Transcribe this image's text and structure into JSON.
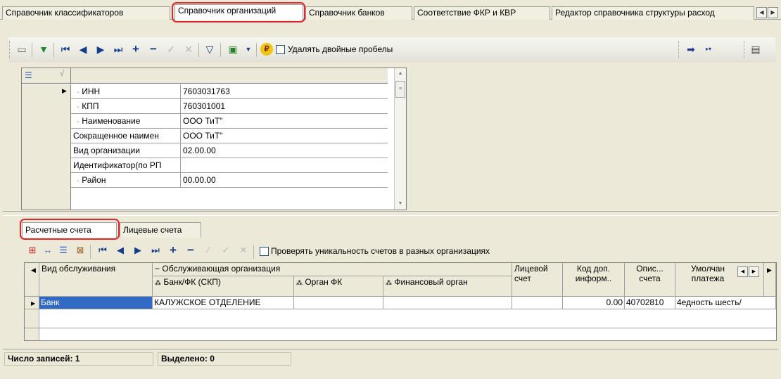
{
  "tabs": [
    {
      "label": "Справочник классификаторов"
    },
    {
      "label": "Справочник организаций"
    },
    {
      "label": "Справочник банков"
    },
    {
      "label": "Соответствие ФКР и КВР"
    },
    {
      "label": "Редактор справочника структуры расход"
    }
  ],
  "active_tab_index": 1,
  "toolbar": {
    "remove_double_spaces_label": "Удалять двойные пробелы",
    "remove_double_spaces_checked": false,
    "ruble_symbol": "₽"
  },
  "organization_fields": [
    {
      "name": "ИНН",
      "value": "7603031763",
      "required": true
    },
    {
      "name": "КПП",
      "value": "760301001",
      "required": true
    },
    {
      "name": "Наименование",
      "value": "ООО ТиТ\"",
      "required": true
    },
    {
      "name": "Сокращенное наимен",
      "value": "ООО ТиТ\"",
      "required": false
    },
    {
      "name": "Вид организации",
      "value": "02.00.00",
      "required": false
    },
    {
      "name": "Идентификатор(по РП",
      "value": "",
      "required": false
    },
    {
      "name": "Район",
      "value": "00.00.00",
      "required": true
    }
  ],
  "sub_tabs": [
    {
      "label": "Расчетные счета"
    },
    {
      "label": "Лицевые счета"
    }
  ],
  "active_sub_tab_index": 0,
  "sub_toolbar": {
    "check_unique_label": "Проверять уникальность счетов в разных организациях",
    "check_unique_checked": false
  },
  "accounts_table": {
    "headers": {
      "service_type": "Вид обслуживания",
      "servicing_org": "Обслуживающая организация",
      "bank_fk": "Банк/ФК (СКП)",
      "organ_fk": "Орган ФК",
      "fin_organ": "Финансовый орган",
      "personal_account": "Лицевой счет",
      "add_info_code": "Код доп. информ..",
      "account_desc": "Опис... счета",
      "default_payment": "Умолчан платежа"
    },
    "rows": [
      {
        "service_type": "Банк",
        "bank_fk": "КАЛУЖСКОЕ ОТДЕЛЕНИЕ",
        "organ_fk": "",
        "fin_organ": "",
        "personal_account": "",
        "add_info_code": "0.00",
        "account_desc": "40702810",
        "default_payment": "4едность шесть/"
      }
    ]
  },
  "status": {
    "records_label": "Число записей:",
    "records_count": "1",
    "selected_label": "Выделено:",
    "selected_count": "0"
  },
  "colors": {
    "highlight": "#e0282c",
    "selection": "#316ac5",
    "window_bg": "#ece9d8"
  }
}
